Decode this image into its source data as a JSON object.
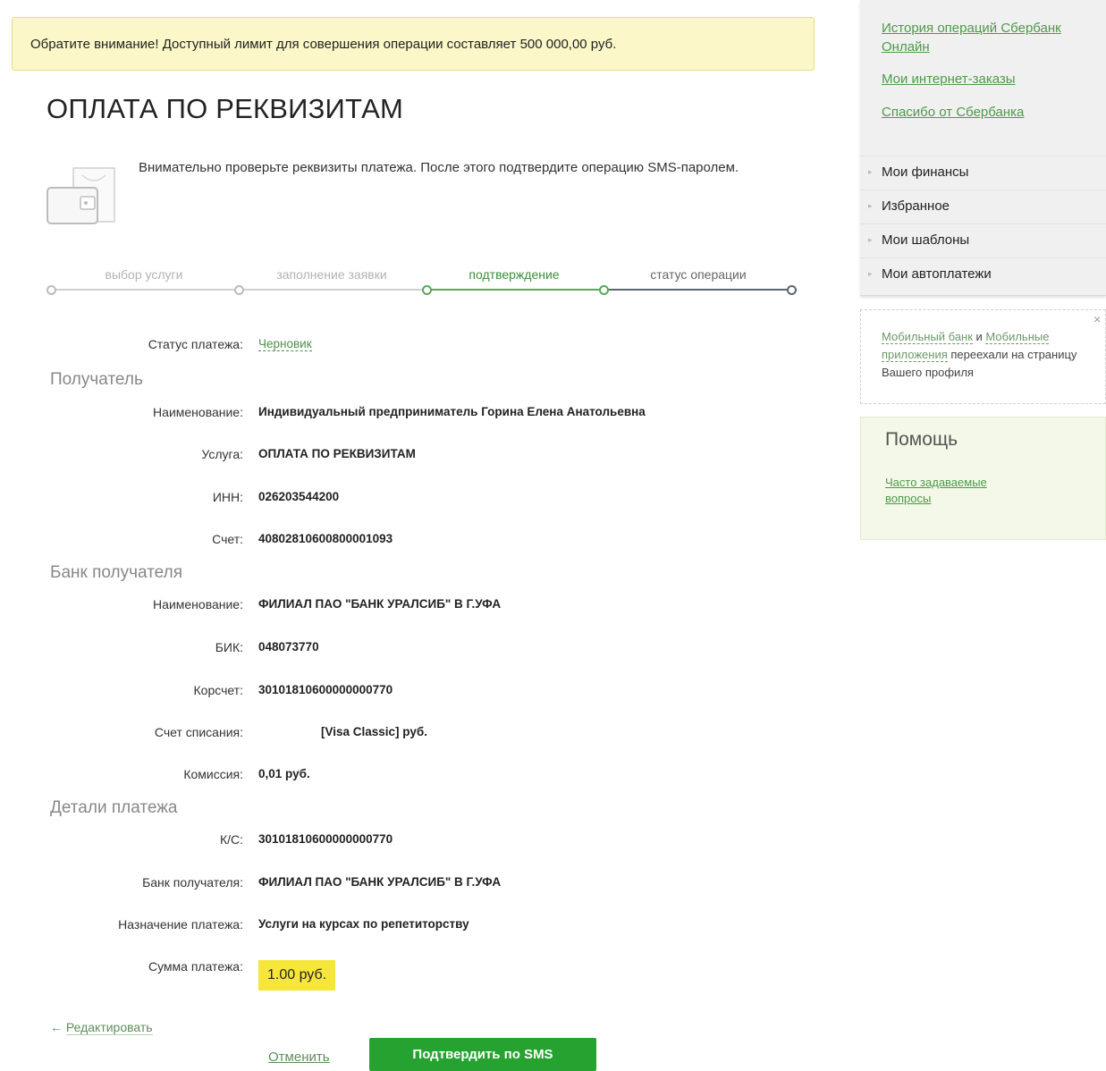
{
  "notice": "Обратите внимание! Доступный лимит для совершения операции составляет 500 000,00 руб.",
  "title": "ОПЛАТА ПО РЕКВИЗИТАМ",
  "hint": "Внимательно проверьте реквизиты платежа. После этого подтвердите операцию SMS-паролем.",
  "steps": [
    {
      "label": "выбор услуги",
      "state": "done"
    },
    {
      "label": "заполнение заявки",
      "state": "done"
    },
    {
      "label": "подтверждение",
      "state": "active"
    },
    {
      "label": "статус операции",
      "state": "next"
    }
  ],
  "status": {
    "label": "Статус платежа:",
    "value": "Черновик"
  },
  "sections": {
    "recipient": "Получатель",
    "bank": "Банк получателя",
    "details": "Детали платежа"
  },
  "recipient": [
    {
      "label": "Наименование:",
      "value": "Индивидуальный предприниматель Горина Елена Анатольевна"
    },
    {
      "label": "Услуга:",
      "value": "ОПЛАТА ПО РЕКВИЗИТАМ"
    },
    {
      "label": "ИНН:",
      "value": "026203544200"
    },
    {
      "label": "Счет:",
      "value": "40802810600800001093"
    }
  ],
  "bank": [
    {
      "label": "Наименование:",
      "value": "ФИЛИАЛ ПАО \"БАНК УРАЛСИБ\" В Г.УФА"
    },
    {
      "label": "БИК:",
      "value": "048073770"
    },
    {
      "label": "Корсчет:",
      "value": "30101810600000000770"
    },
    {
      "label": "Счет списания:",
      "value": "[Visa Classic]  руб."
    },
    {
      "label": "Комиссия:",
      "value": "0,01 руб."
    }
  ],
  "details": [
    {
      "label": "К/С:",
      "value": "30101810600000000770"
    },
    {
      "label": "Банк получателя:",
      "value": "ФИЛИАЛ ПАО \"БАНК УРАЛСИБ\" В Г.УФА"
    },
    {
      "label": "Назначение платежа:",
      "value": "Услуги на курсах по репетиторству"
    }
  ],
  "amount": {
    "label": "Сумма платежа:",
    "value": "1.00 руб."
  },
  "actions": {
    "edit": "Редактировать",
    "cancel": "Отменить",
    "confirm": "Подтвердить по SMS"
  },
  "sidebar": {
    "links": [
      "История операций Сбербанк Онлайн",
      "Мои интернет-заказы",
      "Спасибо от Сбербанка"
    ],
    "menu": [
      "Мои финансы",
      "Избранное",
      "Мои шаблоны",
      "Мои автоплатежи"
    ],
    "mobile": {
      "link1": "Мобильный банк",
      "and": " и ",
      "link2": "Мобильные приложения",
      "rest": " переехали на страницу Вашего профиля",
      "close": "×"
    },
    "help": {
      "title": "Помощь",
      "link": "Часто задаваемые вопросы"
    }
  },
  "colors": {
    "accent": "#25a22f",
    "notice_bg": "#fbf7c9",
    "amount_bg": "#f7e63a"
  }
}
